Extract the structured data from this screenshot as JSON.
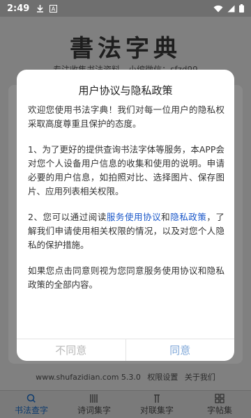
{
  "status_bar": {
    "time": "2:49",
    "icons": [
      "download-icon",
      "a-badge-icon",
      "wifi-icon",
      "signal-icon",
      "battery-icon"
    ]
  },
  "app": {
    "logo_title": "書法字典",
    "sub_line": "专注收集书法资料，小编微信：sfzd99",
    "footer": {
      "url_version": "www.shufazidian.com 5.3.0",
      "permission_settings": "权限设置",
      "about_us": "关于我们"
    },
    "nav": [
      {
        "label": "书法查字",
        "icon": "search-icon",
        "active": true
      },
      {
        "label": "诗词集字",
        "icon": "columns-icon",
        "active": false
      },
      {
        "label": "对联集字",
        "icon": "couplet-icon",
        "active": false
      },
      {
        "label": "字帖集",
        "icon": "grid-icon",
        "active": false
      }
    ]
  },
  "dialog": {
    "title": "用户协议与隐私政策",
    "para1": "欢迎您使用书法字典！我们对每一位用户的隐私权采取高度尊重且保护的态度。",
    "para2": "1、为了更好的提供查询书法字体等服务，本APP会对您个人设备用户信息的收集和使用的说明。申请必要的用户信息，如拍照对比、选择图片、保存图片、应用列表相关权限。",
    "para3_prefix": "2、您可以通过阅读",
    "para3_link1": "服务使用协议",
    "para3_and": "和",
    "para3_link2": "隐私政策",
    "para3_suffix": "，了解我们申请使用相关权限的情况，以及对您个人隐私的保护措施。",
    "para4": "如果您点击同意则视为您同意服务使用协议和隐私政策的全部内容。",
    "disagree_label": "不同意",
    "agree_label": "同意"
  },
  "colors": {
    "overlay": "#808080",
    "link": "#1a57c9",
    "agree": "#7fa7d8",
    "disagree": "#b8b8b8"
  }
}
